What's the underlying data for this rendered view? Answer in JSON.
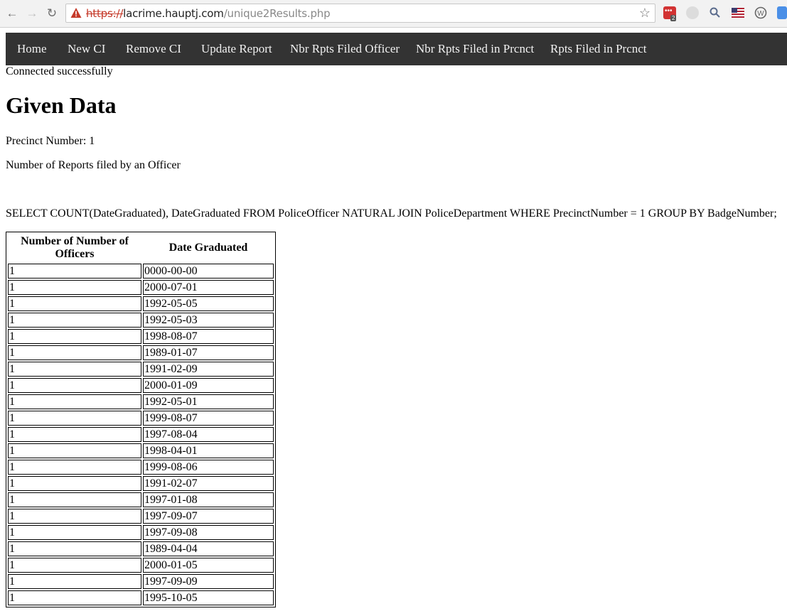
{
  "browser": {
    "url_scheme": "https://",
    "url_host": "lacrime.hauptj.com",
    "url_path": "/unique2Results.php",
    "extension_badge": "2"
  },
  "nav": {
    "items": [
      "Home",
      "New CI",
      "Remove CI",
      "Update Report",
      "Nbr Rpts Filed Officer",
      "Nbr Rpts Filed in Prcnct",
      "Rpts Filed in Prcnct"
    ]
  },
  "page": {
    "status": "Connected successfully",
    "heading": "Given Data",
    "precinct_line": "Precinct Number: 1",
    "description": "Number of Reports filed by an Officer",
    "query": "SELECT COUNT(DateGraduated), DateGraduated FROM PoliceOfficer NATURAL JOIN PoliceDepartment WHERE PrecinctNumber = 1 GROUP BY BadgeNumber;"
  },
  "table": {
    "headers": [
      "Number of Number of Officers",
      "Date Graduated"
    ],
    "rows": [
      [
        "1",
        "0000-00-00"
      ],
      [
        "1",
        "2000-07-01"
      ],
      [
        "1",
        "1992-05-05"
      ],
      [
        "1",
        "1992-05-03"
      ],
      [
        "1",
        "1998-08-07"
      ],
      [
        "1",
        "1989-01-07"
      ],
      [
        "1",
        "1991-02-09"
      ],
      [
        "1",
        "2000-01-09"
      ],
      [
        "1",
        "1992-05-01"
      ],
      [
        "1",
        "1999-08-07"
      ],
      [
        "1",
        "1997-08-04"
      ],
      [
        "1",
        "1998-04-01"
      ],
      [
        "1",
        "1999-08-06"
      ],
      [
        "1",
        "1991-02-07"
      ],
      [
        "1",
        "1997-01-08"
      ],
      [
        "1",
        "1997-09-07"
      ],
      [
        "1",
        "1997-09-08"
      ],
      [
        "1",
        "1989-04-04"
      ],
      [
        "1",
        "2000-01-05"
      ],
      [
        "1",
        "1997-09-09"
      ],
      [
        "1",
        "1995-10-05"
      ]
    ]
  },
  "colors": {
    "navbar_bg": "#333333",
    "navbar_text": "#f2f2f2",
    "insecure_scheme": "#c53929"
  }
}
